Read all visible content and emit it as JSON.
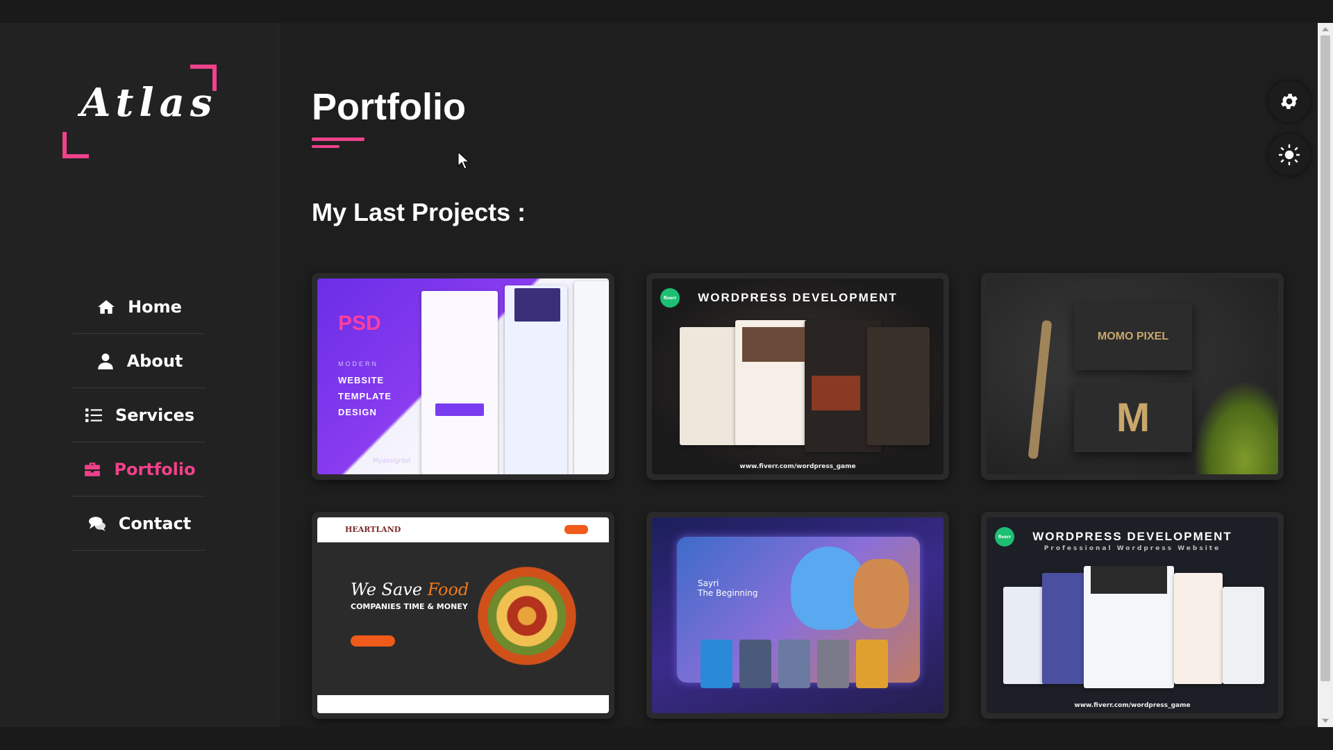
{
  "brand": {
    "logo_text": "Atlas",
    "accent_color": "#f0418c"
  },
  "sidebar": {
    "items": [
      {
        "label": "Home",
        "icon": "home-icon",
        "active": false
      },
      {
        "label": "About",
        "icon": "user-icon",
        "active": false
      },
      {
        "label": "Services",
        "icon": "list-icon",
        "active": false
      },
      {
        "label": "Portfolio",
        "icon": "briefcase-icon",
        "active": true
      },
      {
        "label": "Contact",
        "icon": "comments-icon",
        "active": false
      }
    ]
  },
  "main": {
    "title": "Portfolio",
    "section_title": "My Last Projects :"
  },
  "projects": [
    {
      "name": "psd-website-template",
      "label": "PSD",
      "lines": [
        "MODERN",
        "WEBSITE",
        "TEMPLATE",
        "DESIGN"
      ],
      "brand": "Mydesignbd"
    },
    {
      "name": "wordpress-development-restaurant",
      "title": "WORDPRESS DEVELOPMENT",
      "badge": "fiverr",
      "url": "www.fiverr.com/wordpress_game"
    },
    {
      "name": "momo-pixel-branding",
      "title": "MOMO PIXEL",
      "mark": "M"
    },
    {
      "name": "heartland-food-website",
      "brand": "HEARTLAND",
      "headline_a": "We Save",
      "headline_b": "Food",
      "subline": "COMPANIES TIME & MONEY"
    },
    {
      "name": "game-ui",
      "title": "Sayri",
      "subtitle": "The Beginning"
    },
    {
      "name": "wordpress-development-professional",
      "title": "WORDPRESS DEVELOPMENT",
      "subtitle": "Professional Wordpress Website",
      "badge": "fiverr",
      "url": "www.fiverr.com/wordpress_game"
    }
  ],
  "controls": {
    "settings_icon": "gear-icon",
    "theme_icon": "sun-icon"
  }
}
